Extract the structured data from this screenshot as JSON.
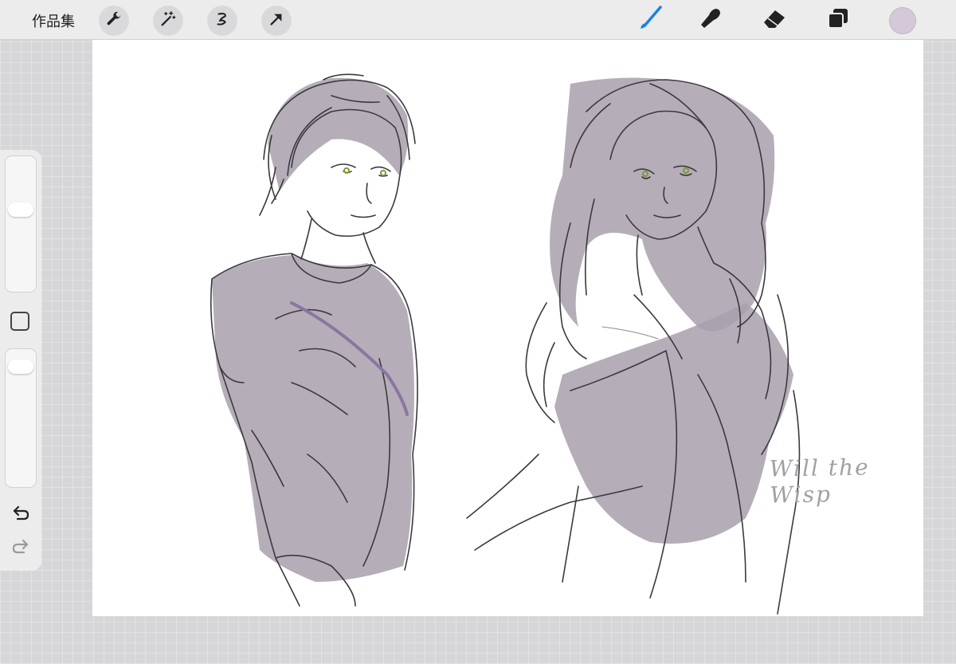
{
  "topbar": {
    "gallery_label": "作品集",
    "left_tools": [
      "wrench-icon",
      "magic-wand-icon",
      "selection-icon",
      "transform-arrow-icon"
    ],
    "right_tools": [
      "brush-icon",
      "smudge-icon",
      "eraser-icon",
      "layers-icon"
    ],
    "current_color": "#d5c8d9",
    "active_tool_color": "#1f7fe6"
  },
  "sidebar": {
    "brush_size_fraction": 0.62,
    "opacity_fraction": 0.93,
    "modify_button_icon": "square-icon",
    "undo_icon": "undo-icon",
    "redo_icon": "redo-icon"
  },
  "canvas": {
    "signature": "Will the Wisp",
    "fill_color": "#a8a0ad",
    "line_color": "#3a3a3c",
    "eye_color": "#7a9a3a"
  }
}
